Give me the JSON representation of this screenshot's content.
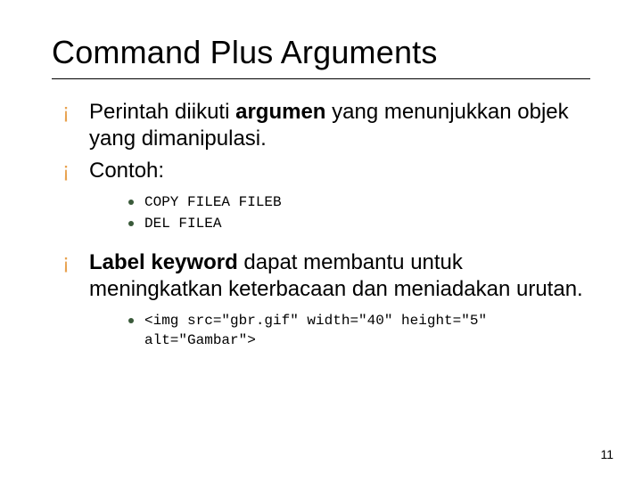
{
  "title": "Command Plus Arguments",
  "bullets": {
    "b1_pre": "Perintah diikuti ",
    "b1_bold": "argumen",
    "b1_post": " yang menunjukkan objek yang dimanipulasi.",
    "b2": "Contoh:",
    "b2_sub1": "COPY FILEA FILEB",
    "b2_sub2": "DEL FILEA",
    "b3_bold": "Label keyword",
    "b3_post": " dapat membantu untuk meningkatkan keterbacaan dan meniadakan urutan.",
    "b3_sub1": "<img src=\"gbr.gif\" width=\"40\" height=\"5\" alt=\"Gambar\">"
  },
  "page_number": "11"
}
